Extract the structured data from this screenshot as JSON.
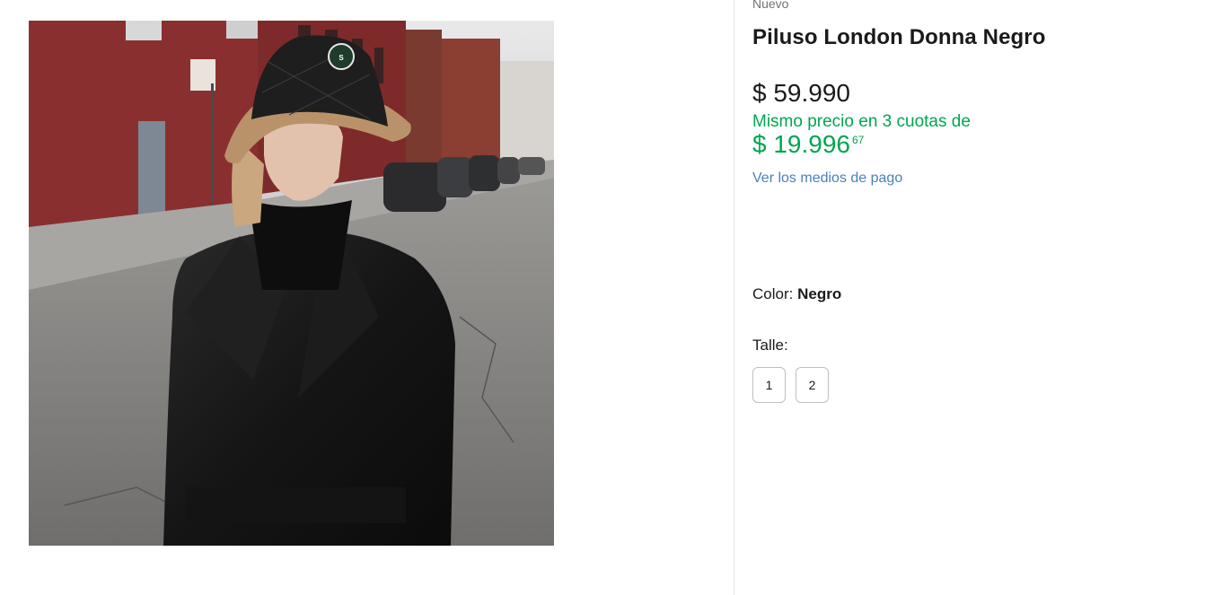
{
  "product": {
    "condition": "Nuevo",
    "title": "Piluso London Donna Negro",
    "image_alt": "product-photo"
  },
  "pricing": {
    "price": "$ 59.990",
    "installments_text": "Mismo precio en 3 cuotas de",
    "installment_amount": "$ 19.996",
    "installment_cents": "67",
    "payment_link": "Ver los medios de pago",
    "installments_color": "#00a650",
    "link_color": "#4a7fbf"
  },
  "variations": {
    "color_label": "Color:",
    "color_value": "Negro",
    "size_label": "Talle:",
    "sizes": [
      "1",
      "2"
    ]
  }
}
